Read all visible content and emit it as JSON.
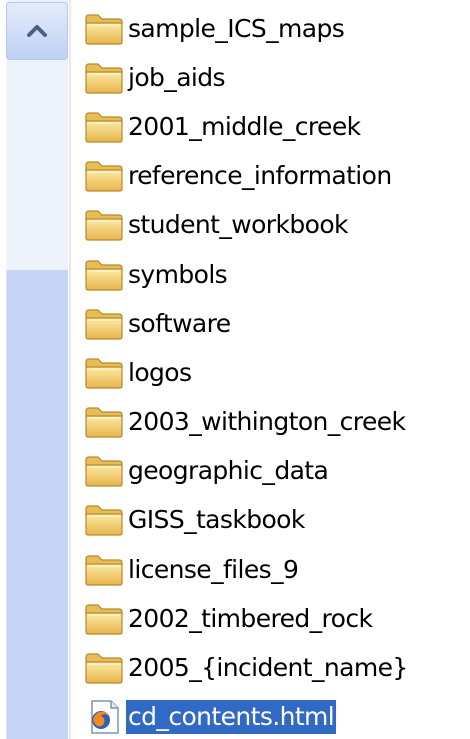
{
  "scrollbar": {
    "up_arrow_icon": "chevron-up-icon",
    "track_color": "#eef3fb",
    "thumb_color": "#c7d6f6"
  },
  "file_list": {
    "items": [
      {
        "name": "sample_ICS_maps",
        "type": "folder",
        "icon": "folder-icon"
      },
      {
        "name": "job_aids",
        "type": "folder",
        "icon": "folder-icon"
      },
      {
        "name": "2001_middle_creek",
        "type": "folder",
        "icon": "folder-icon"
      },
      {
        "name": "reference_information",
        "type": "folder",
        "icon": "folder-icon"
      },
      {
        "name": "student_workbook",
        "type": "folder",
        "icon": "folder-icon"
      },
      {
        "name": "symbols",
        "type": "folder",
        "icon": "folder-icon"
      },
      {
        "name": "software",
        "type": "folder",
        "icon": "folder-icon"
      },
      {
        "name": "logos",
        "type": "folder",
        "icon": "folder-icon"
      },
      {
        "name": "2003_withington_creek",
        "type": "folder",
        "icon": "folder-icon"
      },
      {
        "name": "geographic_data",
        "type": "folder",
        "icon": "folder-icon"
      },
      {
        "name": "GISS_taskbook",
        "type": "folder",
        "icon": "folder-icon"
      },
      {
        "name": "license_files_9",
        "type": "folder",
        "icon": "folder-icon"
      },
      {
        "name": "2002_timbered_rock",
        "type": "folder",
        "icon": "folder-icon"
      },
      {
        "name": "2005_{incident_name}",
        "type": "folder",
        "icon": "folder-icon"
      },
      {
        "name": "cd_contents.html",
        "type": "html",
        "icon": "html-file-icon",
        "selected": true
      }
    ],
    "selection_color": "#316ac5"
  }
}
